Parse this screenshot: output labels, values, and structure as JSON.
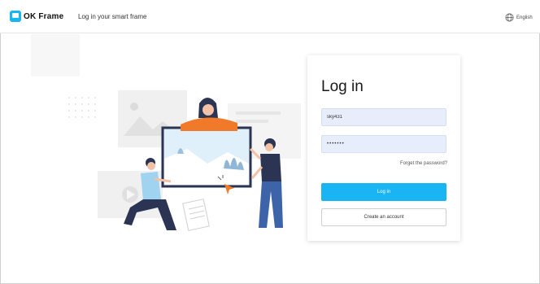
{
  "header": {
    "logo_text": "OK Frame",
    "title": "Log in your smart frame",
    "language": "English"
  },
  "login": {
    "heading": "Log in",
    "username_value": "sky431",
    "password_value": "•••••••",
    "forgot_link": "Forget the password?",
    "login_button": "Log in",
    "create_button": "Create an account"
  },
  "icons": {
    "language": "globe-icon",
    "logo": "frame-logo-icon"
  },
  "colors": {
    "accent": "#19b4f2",
    "field_bg": "#e8edfb",
    "illustration_orange": "#f07a2a",
    "illustration_navy": "#2b3553"
  }
}
